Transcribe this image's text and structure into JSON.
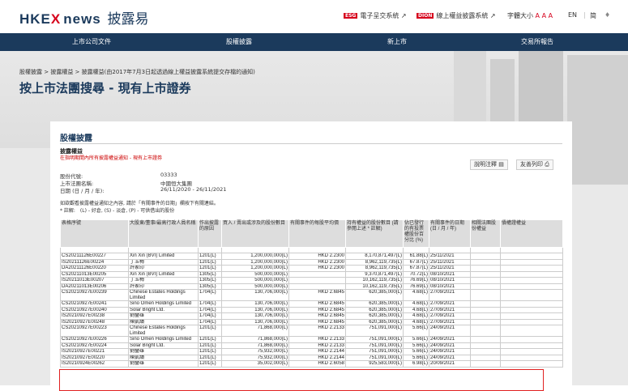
{
  "header": {
    "logo_hkex": "HKE",
    "logo_x": "X",
    "logo_news": "news",
    "logo_zh": "披露易",
    "esg_tag": "ESG",
    "esg_label": "電子呈交系統",
    "dion_tag": "DION",
    "dion_label": "線上權益披露系統",
    "font_label": "字體大小",
    "font_sizes": "A A A",
    "lang_en": "EN",
    "lang_sc": "简"
  },
  "nav": {
    "items": [
      "上市公司文件",
      "股權披露",
      "新上市",
      "交易所報告"
    ]
  },
  "breadcrumb": "股權披露 > 披露權益 > 披露權益(由2017年7月3日起透過線上權益披露系統提交存檔的通知)",
  "page_title": "按上市法團搜尋 - 現有上市證券",
  "card": {
    "title": "股權披露",
    "sub1": "披露權益",
    "sub2": "在指明期間內所有披露權益通知 - 現有上市證券",
    "btn_notes": "說明注釋",
    "btn_print": "友善列印",
    "info": [
      {
        "label": "股份代號:",
        "value": "03333"
      },
      {
        "label": "上市法團名稱:",
        "value": "中國恒大集團"
      },
      {
        "label": "日期 (日 / 月 / 年):",
        "value": "26/11/2020 - 26/11/2021"
      }
    ],
    "note1": "如欲觀看披露權益通知之內容, 請於「有關事件的日期」欄按下有關連結。",
    "note2": "* 註解:　(L) - 好倉, (S) - 淡倉, (P) - 可供借出的股份"
  },
  "table": {
    "headers": [
      "表格序號",
      "大股東/董事/最高行政人員名稱",
      "作出披露的原因",
      "買入 / 賣出或涉及的股份數目",
      "有關事件的每股平均價",
      "持有權益的股份數目 (請參閱上述 * 註解)",
      "佔已發行的有投票權股份百分比 (%)",
      "有關事件的日期 (日 / 月 / 年)",
      "相關法團股份權益",
      "債權證權益"
    ],
    "rows": [
      [
        "",
        "",
        " ",
        "",
        "",
        "",
        "",
        "",
        "",
        ""
      ],
      [
        "CS20211126E00227",
        "Xin Xin (BVI) Limited",
        "1201(L)",
        "1,200,000,000(L)",
        "HKD 2.2300",
        "8,170,871,497(L)",
        "61.88(L)",
        "25/11/2021",
        "",
        ""
      ],
      [
        "IS20211126E00224",
        "丁玉梅",
        "1201(L)",
        "1,200,000,000(L)",
        "HKD 2.2300",
        "8,962,119,735(L)",
        "67.87(L)",
        "25/11/2021",
        "",
        ""
      ],
      [
        "DA20211126E00220",
        "許家印",
        "1201(L)",
        "1,200,000,000(L)",
        "HKD 2.2300",
        "8,962,119,735(L)",
        "67.87(L)",
        "25/11/2021",
        "",
        ""
      ],
      [
        "CS20211013E00205",
        "Xin Xin (BVI) Limited",
        "1305(L)",
        "500,000,000(L)",
        "",
        "9,370,871,497(L)",
        "70.72(L)",
        "08/10/2021",
        "",
        ""
      ],
      [
        "IS20211013E00207",
        "丁玉梅",
        "1305(L)",
        "500,000,000(L)",
        "",
        "10,162,119,735(L)",
        "76.69(L)",
        "08/10/2021",
        "",
        ""
      ],
      [
        "DA20211013E00206",
        "許家印",
        "1305(L)",
        "500,000,000(L)",
        "",
        "10,162,119,735(L)",
        "76.69(L)",
        "08/10/2021",
        "",
        ""
      ],
      [
        "CS20210927E00239",
        "Chinese Estates Holdings Limited",
        "1704(L)",
        "130,706,000(L)",
        "HKD 2.6845",
        "620,385,000(L)",
        "4.68(L)",
        "27/09/2021",
        "",
        ""
      ],
      [
        "CS20210927E00241",
        "Sino Omen Holdings Limited",
        "1704(L)",
        "130,706,000(L)",
        "HKD 2.6845",
        "620,385,000(L)",
        "4.68(L)",
        "27/09/2021",
        "",
        ""
      ],
      [
        "CS20210927E00240",
        "Solar Bright Ltd.",
        "1704(L)",
        "130,706,000(L)",
        "HKD 2.6845",
        "620,385,000(L)",
        "4.68(L)",
        "27/09/2021",
        "",
        ""
      ],
      [
        "IS20210927E00238",
        "劉鑾雄",
        "1704(L)",
        "130,706,000(L)",
        "HKD 2.6845",
        "620,385,000(L)",
        "4.68(L)",
        "27/09/2021",
        "",
        ""
      ],
      [
        "IS20210927E00248",
        "陳凱韻",
        "1704(L)",
        "130,706,000(L)",
        "HKD 2.6845",
        "620,385,000(L)",
        "4.68(L)",
        "27/09/2021",
        "",
        ""
      ],
      [
        "CS20210927E00223",
        "Chinese Estates Holdings Limited",
        "1201(L)",
        "71,868,000(L)",
        "HKD 2.2133",
        "751,091,000(L)",
        "5.66(L)",
        "24/09/2021",
        "",
        ""
      ],
      [
        "CS20210927E00226",
        "Sino Omen Holdings Limited",
        "1201(L)",
        "71,868,000(L)",
        "HKD 2.2133",
        "751,091,000(L)",
        "5.66(L)",
        "24/09/2021",
        "",
        ""
      ],
      [
        "CS20210927E00224",
        "Solar Bright Ltd.",
        "1201(L)",
        "71,868,000(L)",
        "HKD 2.2133",
        "751,091,000(L)",
        "5.66(L)",
        "24/09/2021",
        "",
        ""
      ],
      [
        "IS20210927E00221",
        "劉鑾雄",
        "1201(L)",
        "75,932,000(L)",
        "HKD 2.2144",
        "751,091,000(L)",
        "5.66(L)",
        "24/09/2021",
        "",
        ""
      ],
      [
        "IS20210927E00220",
        "陳凱韻",
        "1201(L)",
        "75,932,000(L)",
        "HKD 2.2144",
        "751,091,000(L)",
        "5.66(L)",
        "24/09/2021",
        "",
        ""
      ],
      [
        "IS20210924E00262",
        "劉鑾雄",
        "1201(L)",
        "35,002,000(L)",
        "HKD 2.6058",
        "925,583,000(L)",
        "6.98(L)",
        "20/09/2021",
        "",
        ""
      ]
    ]
  }
}
